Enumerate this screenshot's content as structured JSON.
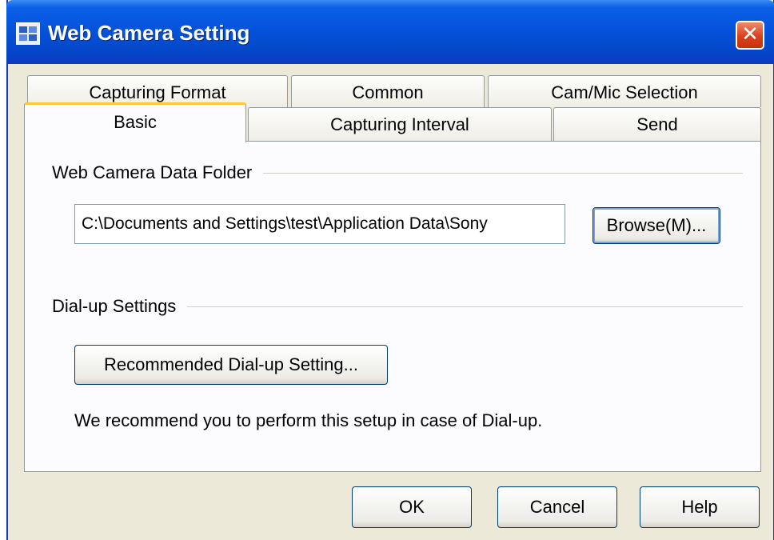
{
  "window": {
    "title": "Web Camera Setting",
    "close_glyph": "✕",
    "icon": "web-camera-app-icon"
  },
  "tabs": {
    "row1": [
      {
        "label": "Capturing Format"
      },
      {
        "label": "Common"
      },
      {
        "label": "Cam/Mic Selection"
      }
    ],
    "row2": [
      {
        "label": "Basic",
        "active": true
      },
      {
        "label": "Capturing Interval"
      },
      {
        "label": "Send"
      }
    ]
  },
  "data_folder": {
    "group_label": "Web Camera Data Folder",
    "path_value": "C:\\Documents and Settings\\test\\Application Data\\Sony",
    "browse_label": "Browse(M)..."
  },
  "dialup": {
    "group_label": "Dial-up Settings",
    "button_label": "Recommended Dial-up Setting...",
    "hint": "We recommend you to perform this setup in case of Dial-up."
  },
  "footer": {
    "ok_label": "OK",
    "cancel_label": "Cancel",
    "help_label": "Help"
  },
  "colors": {
    "title_bar": "#0553dc",
    "close_button": "#d9401c",
    "active_tab_accent": "#ffc83c",
    "dialog_face": "#ece9d8"
  }
}
